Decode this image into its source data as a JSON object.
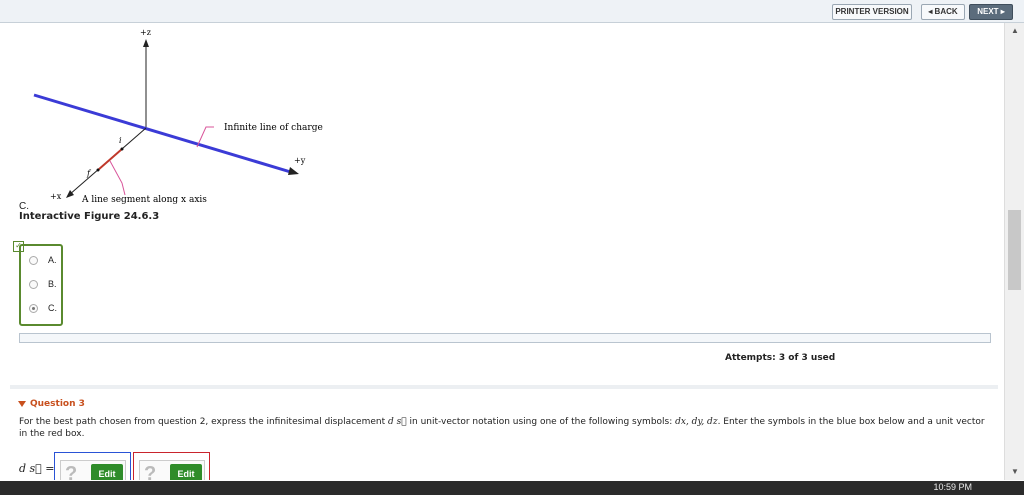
{
  "toolbar": {
    "printer": "PRINTER VERSION",
    "back": "◂ BACK",
    "next": "NEXT ▸"
  },
  "figure": {
    "axis_z": "+z",
    "axis_y": "+y",
    "axis_x": "+x",
    "point_i": "i",
    "point_f": "f",
    "label_line": "Infinite line of charge",
    "label_segment": "A line segment along x axis",
    "colors": {
      "charge_line": "#3b3bd6",
      "segment": "#c0392b",
      "leader": "#d9549a"
    }
  },
  "option_caption": "C.",
  "figure_title": "Interactive Figure 24.6.3",
  "choices": [
    {
      "label": "A.",
      "selected": false
    },
    {
      "label": "B.",
      "selected": false
    },
    {
      "label": "C.",
      "selected": true
    }
  ],
  "attempts": "Attempts: 3 of 3 used",
  "question": {
    "title": "Question 3",
    "text_part1": "For the best path chosen from question 2, express the infinitesimal displacement ",
    "text_ds": "d s⃗",
    "text_part2": " in unit-vector notation using one of the following symbols: ",
    "text_symbols": "dx, dy, dz",
    "text_part3": ". Enter the symbols in the blue box below and a unit vector in the red box.",
    "ds_label": "d s⃗ =",
    "placeholder": "?",
    "edit": "Edit"
  },
  "taskbar": {
    "clock": "10:59 PM"
  }
}
